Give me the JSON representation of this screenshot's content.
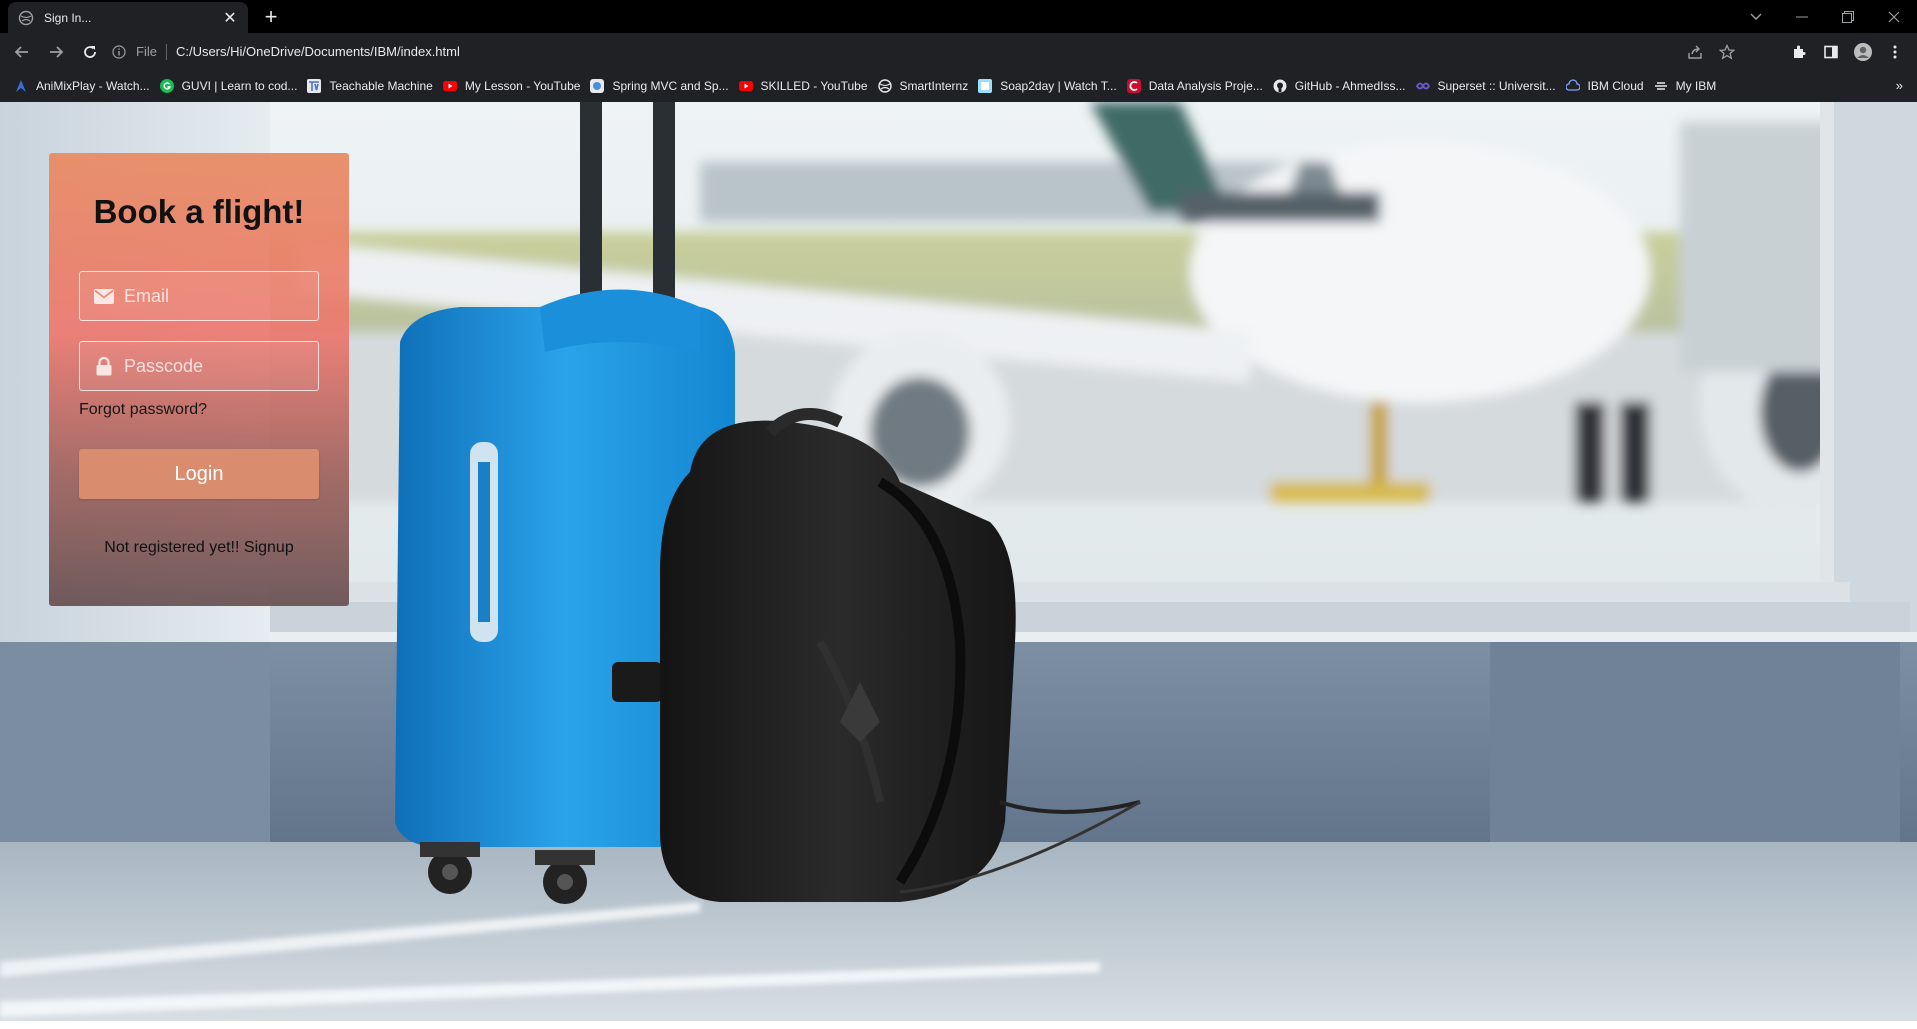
{
  "browser": {
    "tab_title": "Sign In...",
    "tab_close": "✕",
    "new_tab": "+",
    "scheme_label": "File",
    "url": "C:/Users/Hi/OneDrive/Documents/IBM/index.html",
    "bookmarks_more": "»",
    "bookmarks": [
      {
        "label": "AniMixPlay - Watch...",
        "icon": "animix-icon",
        "color": "#3b6fd8"
      },
      {
        "label": "GUVI | Learn to cod...",
        "icon": "guvi-icon",
        "color": "#1db954"
      },
      {
        "label": "Teachable Machine",
        "icon": "teachable-machine-icon",
        "color": "#4a6fd1"
      },
      {
        "label": "My Lesson - YouTube",
        "icon": "youtube-icon",
        "color": "#ff0000"
      },
      {
        "label": "Spring MVC and Sp...",
        "icon": "spring-icon",
        "color": "#4a90d9"
      },
      {
        "label": "SKILLED - YouTube",
        "icon": "youtube-icon",
        "color": "#ff0000"
      },
      {
        "label": "SmartInternz",
        "icon": "globe-icon",
        "color": "#e8eaed"
      },
      {
        "label": "Soap2day | Watch T...",
        "icon": "soap2day-icon",
        "color": "#9be0ff"
      },
      {
        "label": "Data Analysis Proje...",
        "icon": "coursera-c-icon",
        "color": "#c8102e"
      },
      {
        "label": "GitHub - AhmedIss...",
        "icon": "github-icon",
        "color": "#e8eaed"
      },
      {
        "label": "Superset :: Universit...",
        "icon": "superset-icon",
        "color": "#6a5acd"
      },
      {
        "label": "IBM Cloud",
        "icon": "ibm-cloud-icon",
        "color": "#7da2ff"
      },
      {
        "label": "My IBM",
        "icon": "my-ibm-icon",
        "color": "#e8eaed"
      }
    ]
  },
  "login": {
    "title": "Book a flight!",
    "email_placeholder": "Email",
    "password_placeholder": "Passcode",
    "forgot": "Forgot password?",
    "login_button": "Login",
    "signup_prefix": "Not registered yet!! ",
    "signup_link": "Signup"
  },
  "colors": {
    "card_top": "#e88c64",
    "card_bottom": "#644c4e",
    "login_button": "#d98d6e"
  }
}
